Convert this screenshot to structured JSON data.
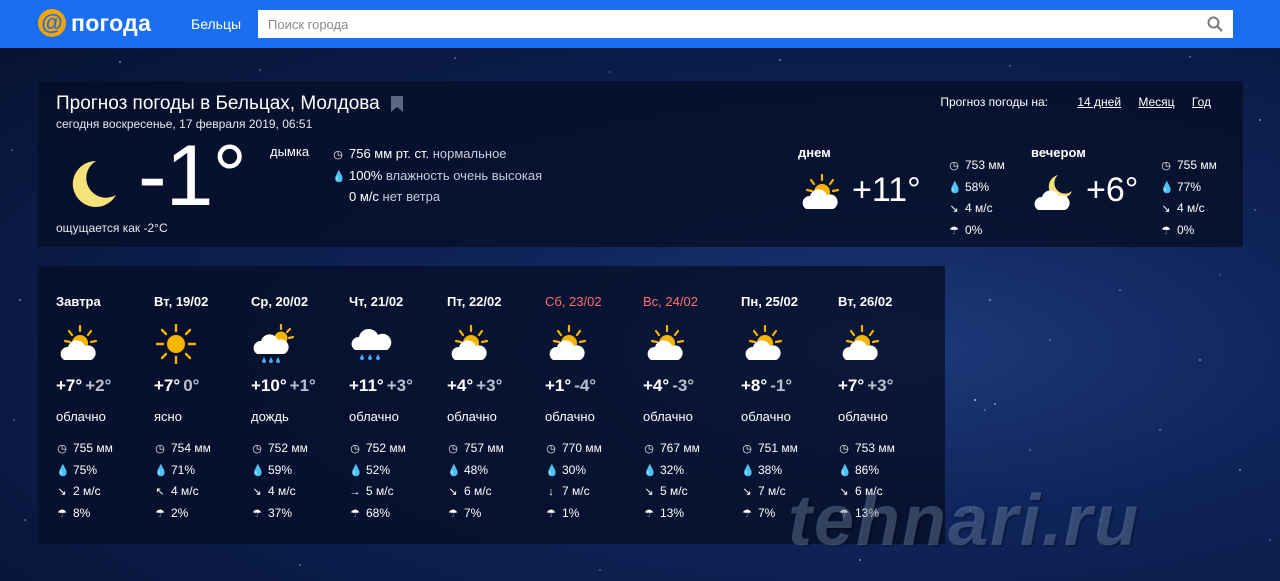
{
  "header": {
    "logo_text": "погода",
    "city": "Бельцы",
    "search_placeholder": "Поиск города"
  },
  "main": {
    "title": "Прогноз погоды в Бельцах, Молдова",
    "subtitle": "сегодня воскресенье, 17 февраля 2019, 06:51",
    "periods_label": "Прогноз погоды на:",
    "periods": [
      "14 дней",
      "Месяц",
      "Год"
    ],
    "now": {
      "icon": "moon-icon",
      "temp": "-1°",
      "condition": "дымка",
      "feels_like": "ощущается как -2°C",
      "pressure": "756 мм рт. ст.",
      "pressure_note": "нормальное",
      "humidity": "100%",
      "humidity_note": "влажность очень высокая",
      "wind": "0 м/с",
      "wind_note": "нет ветра"
    },
    "day": {
      "label": "днем",
      "icon": "sun-cloud-icon",
      "temp": "+11°",
      "pressure": "753 мм",
      "humidity": "58%",
      "wind": "4 м/с",
      "precip": "0%"
    },
    "evening": {
      "label": "вечером",
      "icon": "moon-cloud-icon",
      "temp": "+6°",
      "pressure": "755 мм",
      "humidity": "77%",
      "wind": "4 м/с",
      "precip": "0%"
    }
  },
  "forecast": [
    {
      "date": "Завтра",
      "weekend": false,
      "icon": "sun-cloud-icon",
      "hi": "+7°",
      "lo": "+2°",
      "cond": "облачно",
      "pressure": "755 мм",
      "humidity": "75%",
      "wind_dir": "↘",
      "wind": "2 м/с",
      "precip": "8%"
    },
    {
      "date": "Вт, 19/02",
      "weekend": false,
      "icon": "sun-icon",
      "hi": "+7°",
      "lo": "0°",
      "cond": "ясно",
      "pressure": "754 мм",
      "humidity": "71%",
      "wind_dir": "↖",
      "wind": "4 м/с",
      "precip": "2%"
    },
    {
      "date": "Ср, 20/02",
      "weekend": false,
      "icon": "sun-cloud-rain-icon",
      "hi": "+10°",
      "lo": "+1°",
      "cond": "дождь",
      "pressure": "752 мм",
      "humidity": "59%",
      "wind_dir": "↘",
      "wind": "4 м/с",
      "precip": "37%"
    },
    {
      "date": "Чт, 21/02",
      "weekend": false,
      "icon": "cloud-rain-icon",
      "hi": "+11°",
      "lo": "+3°",
      "cond": "облачно",
      "pressure": "752 мм",
      "humidity": "52%",
      "wind_dir": "→",
      "wind": "5 м/с",
      "precip": "68%"
    },
    {
      "date": "Пт, 22/02",
      "weekend": false,
      "icon": "sun-cloud-icon",
      "hi": "+4°",
      "lo": "+3°",
      "cond": "облачно",
      "pressure": "757 мм",
      "humidity": "48%",
      "wind_dir": "↘",
      "wind": "6 м/с",
      "precip": "7%"
    },
    {
      "date": "Сб, 23/02",
      "weekend": true,
      "icon": "sun-cloud-icon",
      "hi": "+1°",
      "lo": "-4°",
      "cond": "облачно",
      "pressure": "770 мм",
      "humidity": "30%",
      "wind_dir": "↓",
      "wind": "7 м/с",
      "precip": "1%"
    },
    {
      "date": "Вс, 24/02",
      "weekend": true,
      "icon": "sun-cloud-icon",
      "hi": "+4°",
      "lo": "-3°",
      "cond": "облачно",
      "pressure": "767 мм",
      "humidity": "32%",
      "wind_dir": "↘",
      "wind": "5 м/с",
      "precip": "13%"
    },
    {
      "date": "Пн, 25/02",
      "weekend": false,
      "icon": "sun-cloud-icon",
      "hi": "+8°",
      "lo": "-1°",
      "cond": "облачно",
      "pressure": "751 мм",
      "humidity": "38%",
      "wind_dir": "↘",
      "wind": "7 м/с",
      "precip": "7%"
    },
    {
      "date": "Вт, 26/02",
      "weekend": false,
      "icon": "sun-cloud-icon",
      "hi": "+7°",
      "lo": "+3°",
      "cond": "облачно",
      "pressure": "753 мм",
      "humidity": "86%",
      "wind_dir": "↘",
      "wind": "6 м/с",
      "precip": "13%"
    }
  ],
  "watermark": "tehnari.ru",
  "colors": {
    "header_bg": "#1a6ff0",
    "logo_accent": "#f7a400",
    "weekend": "#ff6f6f",
    "sun": "#f7b500"
  }
}
